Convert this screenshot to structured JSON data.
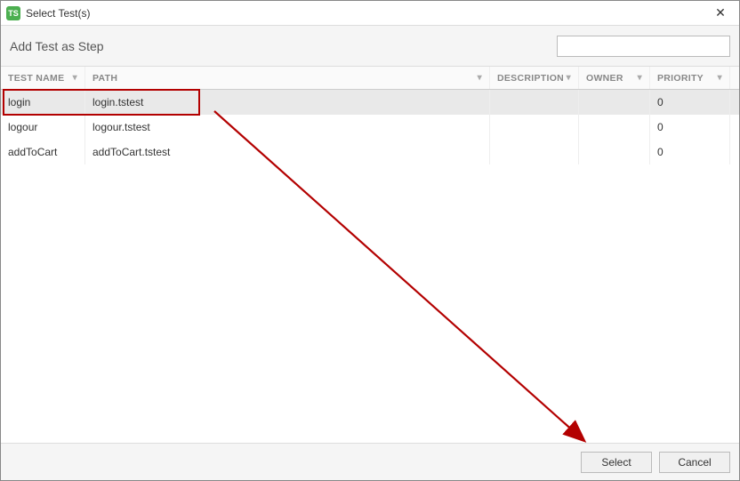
{
  "titlebar": {
    "icon_text": "TS",
    "title": "Select Test(s)"
  },
  "subheader": {
    "label": "Add Test as Step",
    "search_placeholder": ""
  },
  "columns": {
    "name": "TEST NAME",
    "path": "PATH",
    "desc": "DESCRIPTION",
    "owner": "OWNER",
    "priority": "PRIORITY"
  },
  "rows": [
    {
      "name": "login",
      "path": "login.tstest",
      "desc": "",
      "owner": "",
      "priority": "0",
      "selected": true
    },
    {
      "name": "logour",
      "path": "logour.tstest",
      "desc": "",
      "owner": "",
      "priority": "0",
      "selected": false
    },
    {
      "name": "addToCart",
      "path": "addToCart.tstest",
      "desc": "",
      "owner": "",
      "priority": "0",
      "selected": false
    }
  ],
  "footer": {
    "select": "Select",
    "cancel": "Cancel"
  }
}
